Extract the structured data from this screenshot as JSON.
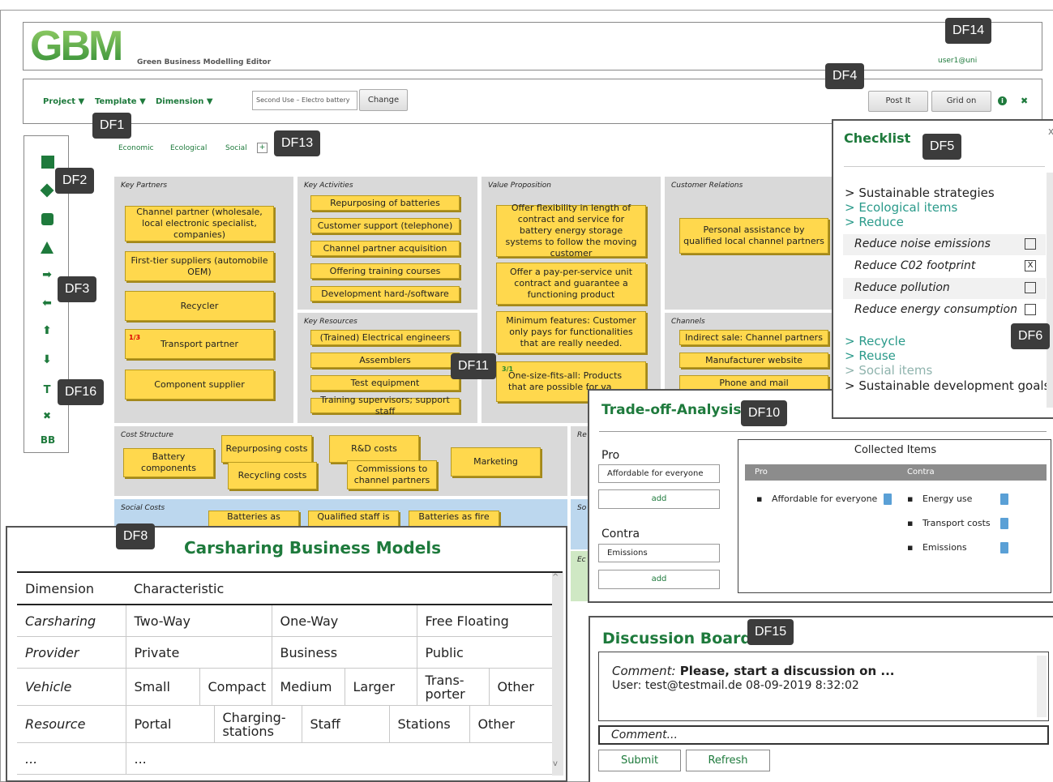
{
  "header": {
    "logo": "GBM",
    "subtitle": "Green Business Modelling Editor",
    "user": "user1@uni"
  },
  "toolbar": {
    "project": "Project ▼",
    "template": "Template ▼",
    "dimension": "Dimension ▼",
    "template_value": "Second Use – Electro battery",
    "change": "Change",
    "postit": "Post It",
    "grid": "Grid on",
    "info": "i",
    "close": "✖"
  },
  "dims": {
    "economic": "Economic",
    "ecological": "Ecological",
    "social": "Social",
    "add": "+"
  },
  "tags": {
    "df1": "DF1",
    "df2": "DF2",
    "df3": "DF3",
    "df4": "DF4",
    "df5": "DF5",
    "df6": "DF6",
    "df8": "DF8",
    "df10": "DF10",
    "df11": "DF11",
    "df13": "DF13",
    "df14": "DF14",
    "df15": "DF15",
    "df16": "DF16"
  },
  "tools": {
    "t": "T",
    "x": "✖",
    "bb": "BB"
  },
  "canvas": {
    "kp": "Key Partners",
    "ka": "Key Activities",
    "vp": "Value Proposition",
    "cr": "Customer Relations",
    "kr": "Key Resources",
    "ch": "Channels",
    "cs": "Cost Structure",
    "re": "Re",
    "sc": "Social Costs",
    "so": "So",
    "ec": "Ec",
    "kp_notes": [
      "Channel partner (wholesale, local electronic specialist, companies)",
      "First-tier suppliers (automobile OEM)",
      "Recycler",
      "Transport partner",
      "Component supplier"
    ],
    "kp_count": "1/3",
    "ka_notes": [
      "Repurposing of batteries",
      "Customer support (telephone)",
      "Channel partner acquisition",
      "Offering training courses",
      "Development hard-/software"
    ],
    "kr_notes": [
      "(Trained) Electrical engineers",
      "Assemblers",
      "Test equipment",
      "Training supervisors; support staff"
    ],
    "vp_notes": [
      "Offer flexibility in length of contract and service for battery energy storage systems to follow the moving customer",
      "Offer a pay-per-service unit contract and guarantee a functioning product",
      "Minimum features: Customer only pays for functionalities that are really needed.",
      "One-size-fits-all: Products that are possible for va"
    ],
    "vp_count": "3/1",
    "cr_notes": [
      "Personal assistance by qualified local channel partners"
    ],
    "ch_notes": [
      "Indirect sale: Channel partners",
      "Manufacturer website",
      "Phone and mail"
    ],
    "cs_notes": [
      "Battery components",
      "Repurposing costs",
      "Recycling costs",
      "R&D costs",
      "Commissions to channel partners",
      "Marketing"
    ],
    "sc_notes": [
      "Batteries as",
      "Qualified staff is",
      "Batteries as fire"
    ]
  },
  "checklist": {
    "title": "Checklist",
    "items": [
      "> Sustainable strategies",
      "> Ecological items",
      "> Reduce",
      "Reduce noise emissions",
      "Reduce C02 footprint",
      "Reduce pollution",
      "Reduce energy consumption",
      "> Recycle",
      "> Reuse",
      "> Social items",
      "> Sustainable development goals"
    ],
    "checked": "X"
  },
  "tradeoff": {
    "title": "Trade-off-Analysis:",
    "pro": "Pro",
    "pro_value": "Affordable for everyone",
    "add": "add",
    "contra": "Contra",
    "contra_value": "Emissions",
    "collected": "Collected Items",
    "col_pro": "Pro",
    "col_contra": "Contra",
    "pro_items": [
      "Affordable for everyone"
    ],
    "contra_items": [
      "Energy use",
      "Transport costs",
      "Emissions"
    ]
  },
  "carsharing": {
    "title": "Carsharing Business Models",
    "h_dim": "Dimension",
    "h_char": "Characteristic",
    "rows": [
      {
        "d": "Carsharing",
        "c": [
          "Two-Way",
          "One-Way",
          "Free Floating"
        ]
      },
      {
        "d": "Provider",
        "c": [
          "Private",
          "Business",
          "Public"
        ]
      },
      {
        "d": "Vehicle",
        "c": [
          "Small",
          "Compact",
          "Medium",
          "Larger",
          "Trans-porter",
          "Other"
        ]
      },
      {
        "d": "Resource",
        "c": [
          "Portal",
          "Charging-stations",
          "Staff",
          "Stations",
          "Other"
        ]
      },
      {
        "d": "...",
        "c": [
          "..."
        ]
      }
    ]
  },
  "discussion": {
    "title": "Discussion Board",
    "comment_label": "Comment:",
    "comment_text": " Please, start a discussion on ...",
    "user_line": "User: test@testmail.de 08-09-2019 8:32:02",
    "input_placeholder": "Comment...",
    "submit": "Submit",
    "refresh": "Refresh"
  }
}
